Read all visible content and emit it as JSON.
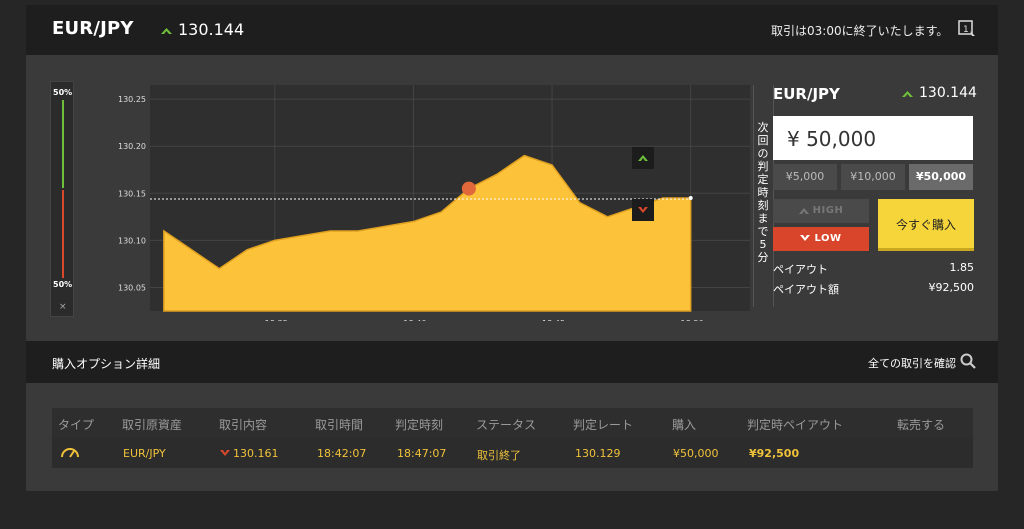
{
  "header": {
    "pair": "EUR/JPY",
    "price": "130.144",
    "notice": "取引は03:00に終了いたします。",
    "up_color": "#6fbf3a"
  },
  "chart": {
    "volume_top": "50%",
    "volume_bottom": "50%",
    "close_label": "×",
    "next_judgment": "次回の判定時刻まで5分",
    "y_ticks": [
      "130.25",
      "130.20",
      "130.15",
      "130.10",
      "130.05"
    ],
    "x_ticks": [
      "18:35",
      "18:40",
      "18:45",
      "18:50"
    ]
  },
  "chart_data": {
    "type": "area",
    "x": [
      "18:31",
      "18:32",
      "18:33",
      "18:34",
      "18:35",
      "18:36",
      "18:37",
      "18:38",
      "18:39",
      "18:40",
      "18:41",
      "18:42",
      "18:43",
      "18:44",
      "18:45",
      "18:46",
      "18:47",
      "18:48",
      "18:49",
      "18:50"
    ],
    "y": [
      130.11,
      130.09,
      130.07,
      130.09,
      130.1,
      130.105,
      130.11,
      130.11,
      130.115,
      130.12,
      130.13,
      130.155,
      130.17,
      130.19,
      130.18,
      130.14,
      130.125,
      130.135,
      130.145,
      130.145
    ],
    "ylim": [
      130.025,
      130.265
    ],
    "reference_rate": 130.144,
    "entry_time": "18:42",
    "fill_color": "#fcc23a"
  },
  "panel": {
    "pair": "EUR/JPY",
    "price": "130.144",
    "amount": "¥ 50,000",
    "presets": [
      "¥5,000",
      "¥10,000",
      "¥50,000"
    ],
    "high_label": "HIGH",
    "low_label": "LOW",
    "buy_label": "今すぐ購入",
    "payout_label": "ペイアウト",
    "payout_value": "1.85",
    "payout_amount_label": "ペイアウト額",
    "payout_amount_value": "¥92,500"
  },
  "details": {
    "title": "購入オプション詳細",
    "link": "全ての取引を確認",
    "columns": [
      "タイプ",
      "取引原資産",
      "取引内容",
      "取引時間",
      "判定時刻",
      "ステータス",
      "判定レート",
      "購入",
      "判定時ペイアウト",
      "転売する"
    ],
    "row": {
      "asset": "EUR/JPY",
      "content": "130.161",
      "trade_time": "18:42:07",
      "judgment_time": "18:47:07",
      "status": "取引終了",
      "judgment_rate": "130.129",
      "purchase": "¥50,000",
      "payout": "¥92,500"
    }
  }
}
